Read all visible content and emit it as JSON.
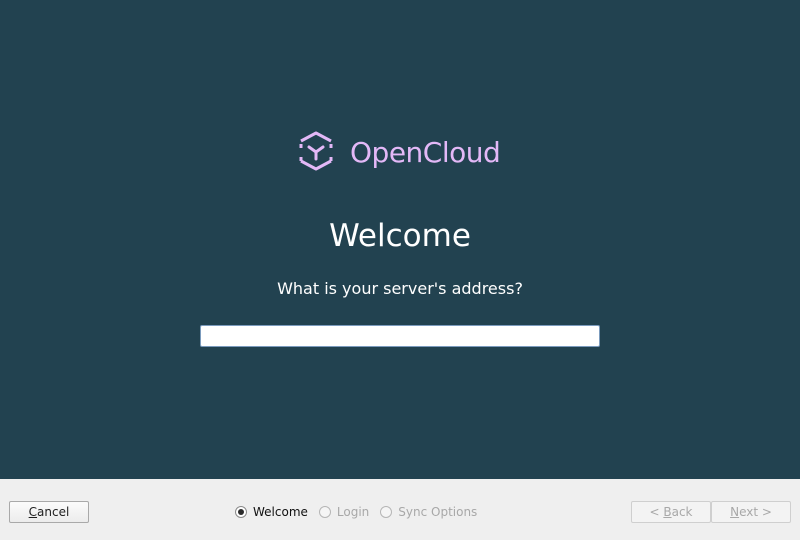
{
  "branding": {
    "name": "OpenCloud",
    "color": "#e3b8f7"
  },
  "page": {
    "title": "Welcome",
    "question": "What is your server's address?"
  },
  "server_input": {
    "value": "",
    "placeholder": ""
  },
  "footer": {
    "cancel": {
      "mnemonic": "C",
      "rest": "ancel"
    },
    "back": {
      "prefix": "< ",
      "mnemonic": "B",
      "rest": "ack"
    },
    "next": {
      "prefix": "",
      "mnemonic": "N",
      "rest": "ext >"
    },
    "steps": [
      {
        "label": "Welcome",
        "checked": true,
        "enabled": true
      },
      {
        "label": "Login",
        "checked": false,
        "enabled": false
      },
      {
        "label": "Sync Options",
        "checked": false,
        "enabled": false
      }
    ]
  },
  "colors": {
    "panel_background": "#224250",
    "footer_background": "#efefef"
  }
}
